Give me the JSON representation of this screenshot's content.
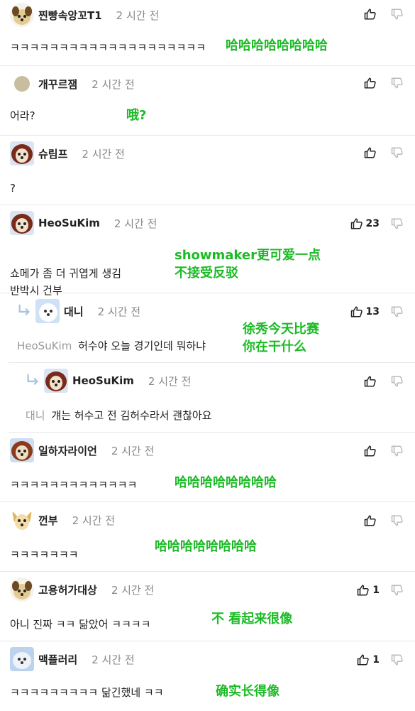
{
  "time_ago": "2 시간 전",
  "colors": {
    "annotation": "#1cbb26",
    "meta": "#888888",
    "divider": "#e8e8e8"
  },
  "comments": [
    {
      "author": "찐빵속앙꼬T1",
      "body": "ㅋㅋㅋㅋㅋㅋㅋㅋㅋㅋㅋㅋㅋㅋㅋㅋㅋㅋㅋㅋ",
      "likes": "",
      "annotation": [
        "哈哈哈哈哈哈哈哈"
      ]
    },
    {
      "author": "개꾸르잼",
      "body": "어라?",
      "likes": "",
      "annotation": [
        "哦?"
      ]
    },
    {
      "author": "슈림프",
      "body": "?",
      "likes": "",
      "annotation": []
    },
    {
      "author": "HeoSuKim",
      "body": "쇼메가 좀 더 귀엽게 생김\n반박시 건부",
      "likes": "23",
      "annotation": [
        "showmaker更可爱一点",
        "不接受反驳"
      ]
    },
    {
      "author": "대니",
      "mention": "HeoSuKim",
      "body": "허수야 오늘 경기인데 뭐하냐",
      "likes": "13",
      "annotation": [
        "徐秀今天比赛",
        "你在干什么"
      ]
    },
    {
      "author": "HeoSuKim",
      "mention": "대니",
      "body": "걔는 허수고 전 김허수라서 괜찮아요",
      "likes": "",
      "annotation": []
    },
    {
      "author": "일하자라이언",
      "body": "ㅋㅋㅋㅋㅋㅋㅋㅋㅋㅋㅋㅋㅋ",
      "likes": "",
      "annotation": [
        "哈哈哈哈哈哈哈哈"
      ]
    },
    {
      "author": "껀부",
      "body": "ㅋㅋㅋㅋㅋㅋㅋ",
      "likes": "",
      "annotation": [
        "哈哈哈哈哈哈哈哈"
      ]
    },
    {
      "author": "고용허가대상",
      "body": "아니 진짜 ㅋㅋ 닮았어 ㅋㅋㅋㅋ",
      "likes": "1",
      "annotation": [
        "不 看起来很像"
      ]
    },
    {
      "author": "맥플러리",
      "body": "ㅋㅋㅋㅋㅋㅋㅋㅋㅋ 닮긴했네 ㅋㅋ",
      "likes": "1",
      "annotation": [
        "确实长得像"
      ]
    }
  ]
}
